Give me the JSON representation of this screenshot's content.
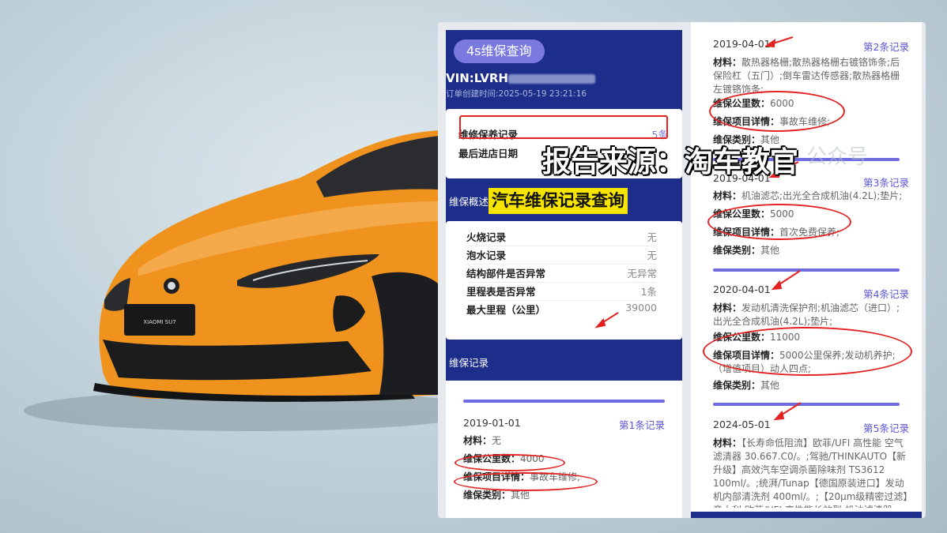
{
  "app": {
    "pill_label": "4s维保查询",
    "vin_label": "VIN:LVRH",
    "create_time": "订单创建时间:2025-05-19 23:21:16"
  },
  "summary": {
    "records_label": "维修保养记录",
    "records_value": "5条",
    "last_visit_label": "最后进店日期"
  },
  "overview": {
    "section_label": "维保概述",
    "rows": [
      {
        "label": "火烧记录",
        "value": "无"
      },
      {
        "label": "泡水记录",
        "value": "无"
      },
      {
        "label": "结构部件是否异常",
        "value": "无异常"
      },
      {
        "label": "里程表是否异常",
        "value": "1条"
      },
      {
        "label": "最大里程（公里）",
        "value": "39000"
      }
    ]
  },
  "records_section_label": "维保记录",
  "records": [
    {
      "date": "2019-01-01",
      "no": "第1条记录",
      "material_label": "材料：",
      "material": "无",
      "mileage_label": "维保公里数：",
      "mileage": "4000",
      "detail_label": "维保项目详情：",
      "detail": "事故车维修;",
      "type_label": "维保类别：",
      "type": "其他"
    },
    {
      "date": "2019-04-01",
      "no": "第2条记录",
      "material_label": "材料：",
      "material": "散热器格栅;散热器格栅右镀铬饰条;后保险杠（五门）;倒车雷达传感器;散热器格栅左镀铬饰条;",
      "mileage_label": "维保公里数：",
      "mileage": "6000",
      "detail_label": "维保项目详情：",
      "detail": "事故车维修;",
      "type_label": "维保类别：",
      "type": "其他"
    },
    {
      "date": "2019-04-01",
      "no": "第3条记录",
      "material_label": "材料：",
      "material": "机油滤芯;出光全合成机油(4.2L);垫片;",
      "mileage_label": "维保公里数：",
      "mileage": "5000",
      "detail_label": "维保项目详情：",
      "detail": "首次免费保养;",
      "type_label": "维保类别：",
      "type": "其他"
    },
    {
      "date": "2020-04-01",
      "no": "第4条记录",
      "material_label": "材料：",
      "material": "发动机清洗保护剂;机油滤芯（进口）;出光全合成机油(4.2L);垫片;",
      "mileage_label": "维保公里数：",
      "mileage": "11000",
      "detail_label": "维保项目详情：",
      "detail": "5000公里保养;发动机养护;（增值项目）动人四点;",
      "type_label": "维保类别：",
      "type": "其他"
    },
    {
      "date": "2024-05-01",
      "no": "第5条记录",
      "material_label": "材料：",
      "material": "【长寿命低阻流】欧菲/UFI 高性能 空气滤清器 30.667.C0/。;驾驰/THINKAUTO【新升级】高效汽车空调杀菌除味剂 TS3612 100ml/。;统湃/Tunap【德国原装进口】发动机内部清洗剂 400ml/。;【20μm级精密过滤】意大利 欧菲/UFI 高性能长效型 机油滤清器"
    }
  ],
  "overlay": {
    "title": "报告来源：淘车教官",
    "tag": "汽车维保记录查询",
    "watermark": "公众号"
  },
  "car": {
    "plate": "XIAOMI SU7",
    "colors": {
      "body": "#f0921e",
      "dark": "#1b1c1e"
    }
  },
  "colors": {
    "panel_blue": "#1c2e8a",
    "accent_purple": "#6f6be0",
    "annotation_red": "#e32222",
    "tag_yellow": "#f7e500"
  }
}
